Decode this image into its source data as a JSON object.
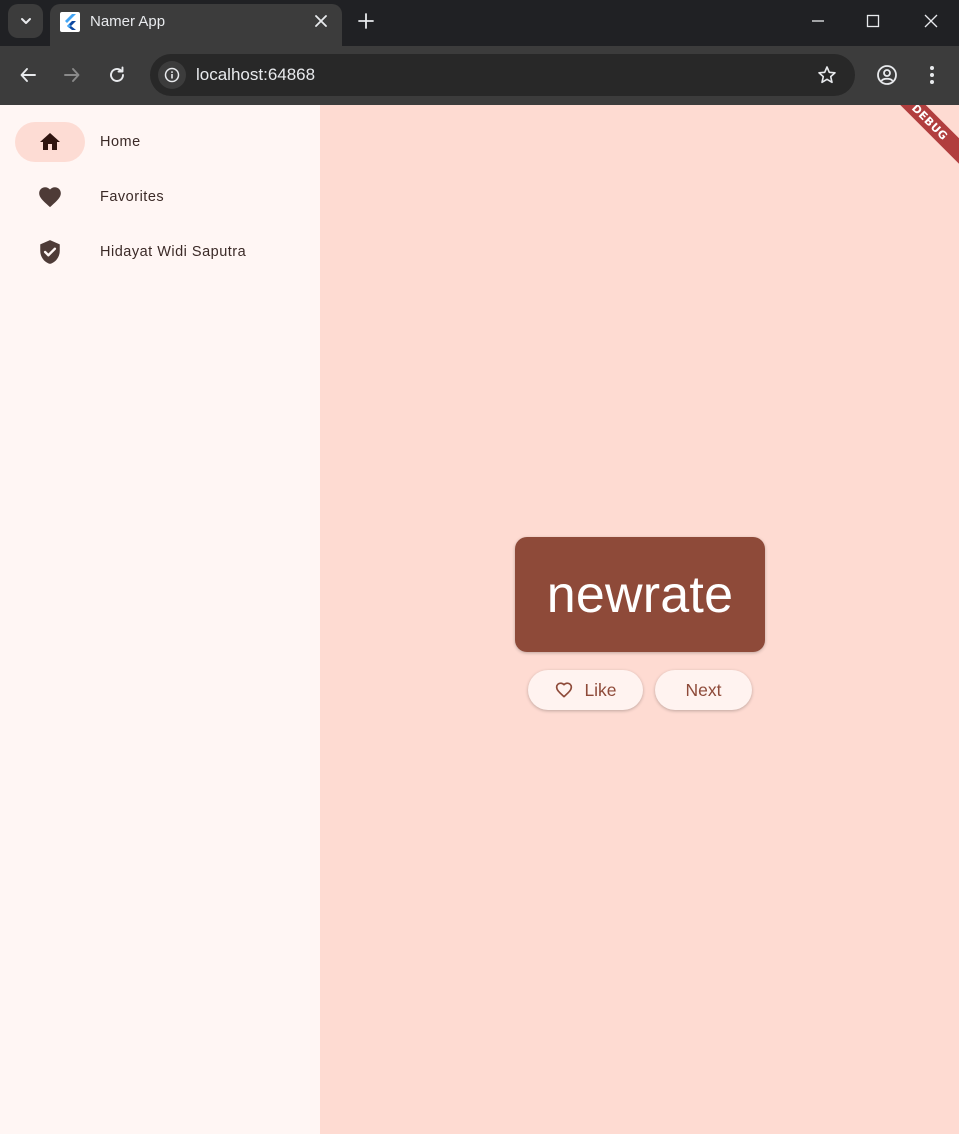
{
  "browser": {
    "tab": {
      "title": "Namer App"
    },
    "url": "localhost:64868"
  },
  "nav": {
    "items": [
      {
        "label": "Home",
        "icon": "home-icon",
        "selected": true
      },
      {
        "label": "Favorites",
        "icon": "heart-icon",
        "selected": false
      },
      {
        "label": "Hidayat Widi Saputra",
        "icon": "verified-shield-icon",
        "selected": false
      }
    ]
  },
  "main": {
    "word": "newrate",
    "like_label": "Like",
    "next_label": "Next"
  },
  "debug_banner": "DEBUG",
  "colors": {
    "rail_bg": "#fff6f4",
    "main_bg": "#fedbd2",
    "card_bg": "#8e4a39",
    "selected_indicator": "#fddcd4",
    "ribbon": "#b13e3e"
  }
}
